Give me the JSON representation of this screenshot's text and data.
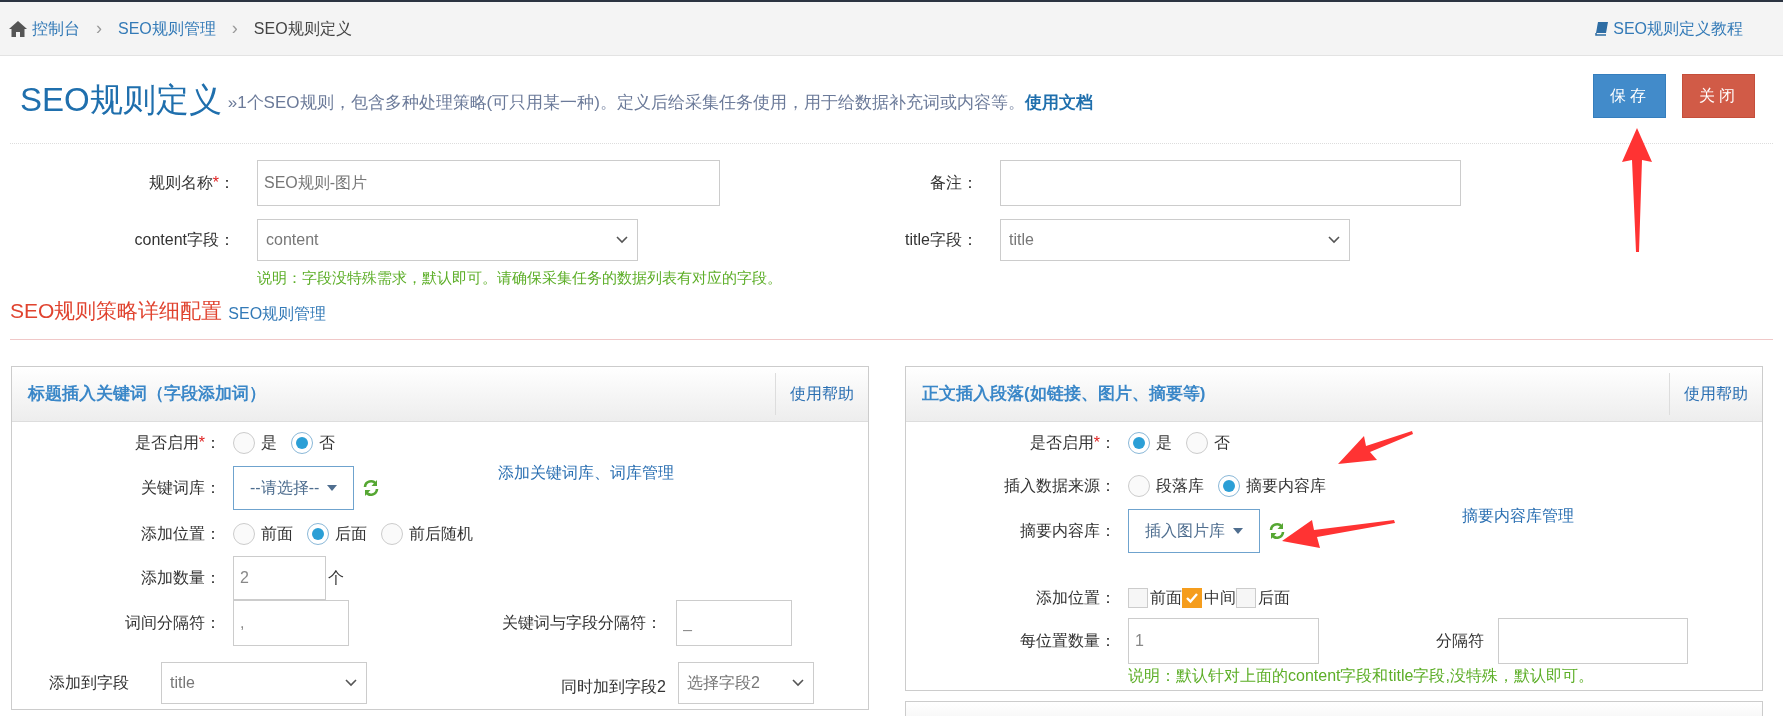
{
  "breadcrumb": {
    "items": [
      {
        "label": "控制台",
        "kind": "home"
      },
      {
        "label": "SEO规则管理",
        "kind": "link"
      },
      {
        "label": "SEO规则定义",
        "kind": "current"
      }
    ],
    "separator": "›",
    "tutorial_link": "SEO规则定义教程"
  },
  "header": {
    "title": "SEO规则定义",
    "description": "»1个SEO规则，包含多种处理策略(可只用某一种)。定义后给采集任务使用，用于给数据补充词或内容等。",
    "doc_link": "使用文档"
  },
  "buttons": [
    {
      "label": "保存",
      "kind": "primary"
    },
    {
      "label": "关闭",
      "kind": "danger"
    }
  ],
  "form": {
    "name": {
      "label": "规则名称",
      "mark": "*",
      "suffix": "：",
      "value": "SEO规则-图片"
    },
    "remark": {
      "label": "备注",
      "suffix": "："
    },
    "content_field": {
      "label": "content字段",
      "suffix": "：",
      "value": "content"
    },
    "title_field": {
      "label": "title字段",
      "suffix": "：",
      "value": "title"
    },
    "note": "说明：字段没特殊需求，默认即可。请确保采集任务的数据列表有对应的字段。"
  },
  "section": {
    "title": "SEO规则策略详细配置",
    "link": "SEO规则管理"
  },
  "panels": [
    {
      "title": "标题插入关键词（字段添加词）",
      "help": "使用帮助",
      "rows": [
        {
          "kind": "radio",
          "label": "是否启用",
          "mark": "*",
          "suffix": "：",
          "options": [
            {
              "label": "是",
              "selected": false
            },
            {
              "label": "否",
              "selected": true
            }
          ]
        },
        {
          "kind": "select-link",
          "label": "关键词库",
          "suffix": "：",
          "value": "--请选择--",
          "link": "添加关键词库、词库管理"
        },
        {
          "kind": "radio",
          "label": "添加位置",
          "suffix": "：",
          "options": [
            {
              "label": "前面",
              "selected": false
            },
            {
              "label": "后面",
              "selected": true
            },
            {
              "label": "前后随机",
              "selected": false
            }
          ]
        },
        {
          "kind": "input-unit",
          "label": "添加数量",
          "suffix": "：",
          "value": "2",
          "unit": "个"
        },
        {
          "kind": "input-pair",
          "label": "词间分隔符",
          "suffix": "：",
          "value": ",",
          "label2": "关键词与字段分隔符",
          "suffix2": "：",
          "value2": "_"
        },
        {
          "kind": "select-pair",
          "label": "添加到字段",
          "value": "title",
          "label2": "同时加到字段2",
          "value2": "选择字段2"
        }
      ]
    },
    {
      "title": "正文插入段落(如链接、图片、摘要等)",
      "help": "使用帮助",
      "rows": [
        {
          "kind": "radio",
          "label": "是否启用",
          "mark": "*",
          "suffix": "：",
          "options": [
            {
              "label": "是",
              "selected": true
            },
            {
              "label": "否",
              "selected": false
            }
          ]
        },
        {
          "kind": "radio",
          "label": "插入数据来源",
          "suffix": "：",
          "options": [
            {
              "label": "段落库",
              "selected": false
            },
            {
              "label": "摘要内容库",
              "selected": true
            }
          ]
        },
        {
          "kind": "select-link",
          "label": "摘要内容库",
          "suffix": "：",
          "value": "插入图片库",
          "link": "摘要内容库管理"
        },
        {
          "kind": "checkbox",
          "label": "添加位置",
          "suffix": "：",
          "options": [
            {
              "label": "前面",
              "checked": false
            },
            {
              "label": "中间",
              "checked": true
            },
            {
              "label": "后面",
              "checked": false
            }
          ]
        },
        {
          "kind": "input-pair",
          "label": "每位置数量",
          "suffix": "：",
          "value": "1",
          "label2": "分隔符"
        },
        {
          "kind": "note",
          "text": "说明：默认针对上面的content字段和title字段,没特殊，默认即可。"
        }
      ]
    }
  ]
}
